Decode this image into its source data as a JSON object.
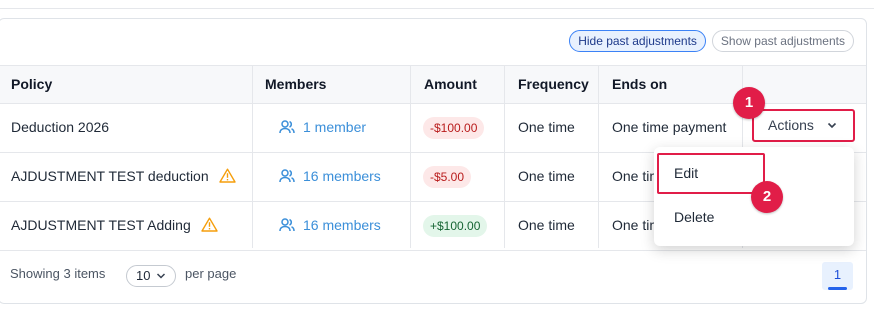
{
  "toggles": {
    "hide_past": "Hide past adjustments",
    "show_past": "Show past adjustments"
  },
  "columns": {
    "policy": "Policy",
    "members": "Members",
    "amount": "Amount",
    "frequency": "Frequency",
    "ends_on": "Ends on"
  },
  "rows": [
    {
      "policy": "Deduction 2026",
      "warning": false,
      "members": "1 member",
      "amount": "-$100.00",
      "amount_sign": "negative",
      "frequency": "One time",
      "ends_on": "One time payment"
    },
    {
      "policy": "AJDUSTMENT TEST deduction",
      "warning": true,
      "members": "16 members",
      "amount": "-$5.00",
      "amount_sign": "negative",
      "frequency": "One time",
      "ends_on": "One tim"
    },
    {
      "policy": "AJDUSTMENT TEST Adding",
      "warning": true,
      "members": "16 members",
      "amount": "+$100.00",
      "amount_sign": "positive",
      "frequency": "One time",
      "ends_on": "One tim"
    }
  ],
  "actions_button": {
    "label": "Actions",
    "icon": "chevron-down-icon"
  },
  "actions_menu": {
    "edit": "Edit",
    "delete": "Delete"
  },
  "steps": {
    "one": "1",
    "two": "2"
  },
  "footer": {
    "showing": "Showing 3 items",
    "per_page_value": "10",
    "per_page_label": "per page",
    "current_page": "1"
  },
  "colors": {
    "accent": "#3b82f6",
    "highlight": "#e11d48",
    "negative_badge": "#fde8e8",
    "positive_badge": "#e3f6ea",
    "warning": "#f59e0b"
  }
}
